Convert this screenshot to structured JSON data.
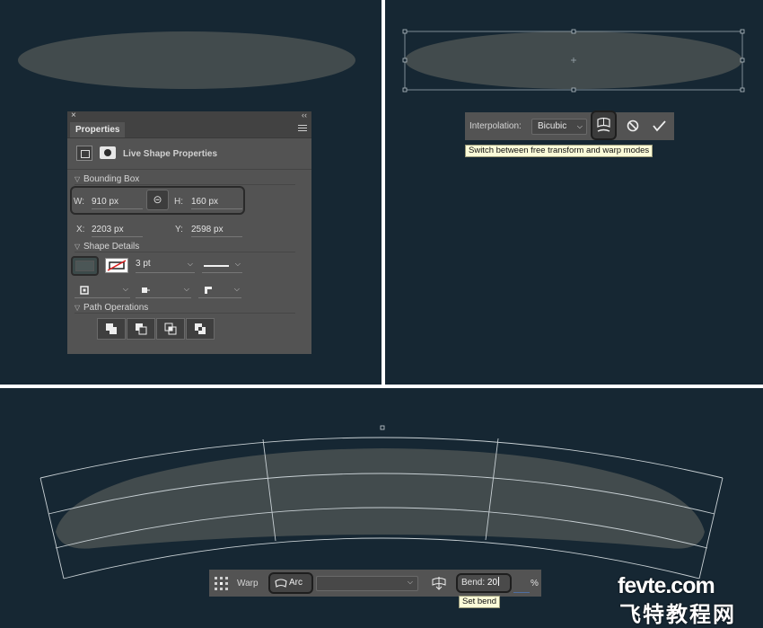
{
  "properties_panel": {
    "close_glyph": "×",
    "collapse_glyph": "‹‹",
    "tab_label": "Properties",
    "live_shape_title": "Live Shape Properties",
    "bounding_box": {
      "label": "Bounding Box",
      "w_label": "W:",
      "w_value": "910 px",
      "h_label": "H:",
      "h_value": "160 px",
      "x_label": "X:",
      "x_value": "2203 px",
      "y_label": "Y:",
      "y_value": "2598 px"
    },
    "shape_details": {
      "label": "Shape Details",
      "stroke_width": "3 pt"
    },
    "path_operations": {
      "label": "Path Operations"
    }
  },
  "transform_bar": {
    "interpolation_label": "Interpolation:",
    "interpolation_value": "Bicubic",
    "tooltip": "Switch between free transform and warp modes"
  },
  "warp_bar": {
    "warp_label": "Warp",
    "style_value": "Arc",
    "bend_label": "Bend:",
    "bend_value": "20",
    "percent": "%",
    "tooltip": "Set bend"
  },
  "watermark": {
    "line1": "fevte.com",
    "line2": "飞特教程网"
  },
  "colors": {
    "canvas": "#162733",
    "shape_fill": "#424b4d",
    "panel": "#535353",
    "tooltip": "#fbfbd8"
  }
}
